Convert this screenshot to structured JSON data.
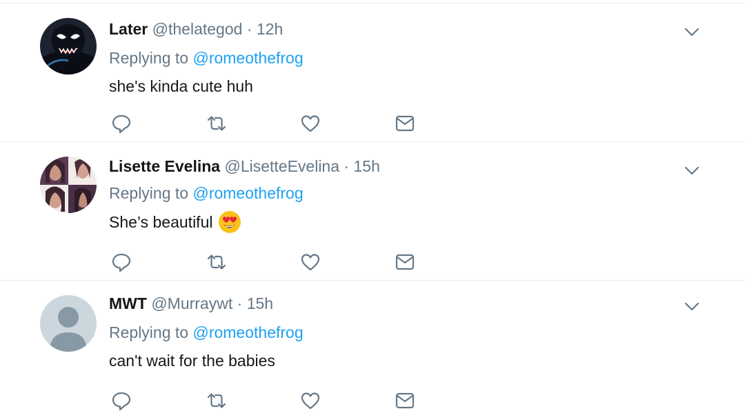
{
  "replies": [
    {
      "display_name": "Later",
      "handle": "@thelategod",
      "time": "12h",
      "replying_prefix": "Replying to",
      "replying_to": "@romeothefrog",
      "text": "she's kinda cute huh",
      "emoji": ""
    },
    {
      "display_name": "Lisette Evelina",
      "handle": "@LisetteEvelina",
      "time": "15h",
      "replying_prefix": "Replying to",
      "replying_to": "@romeothefrog",
      "text": "She’s beautiful",
      "emoji": "heart-eyes-emoji"
    },
    {
      "display_name": "MWT",
      "handle": "@Murraywt",
      "time": "15h",
      "replying_prefix": "Replying to",
      "replying_to": "@romeothefrog",
      "text": "can't wait for the babies",
      "emoji": ""
    }
  ],
  "separator": "·",
  "icons": {
    "reply": "reply-icon",
    "retweet": "retweet-icon",
    "like": "like-icon",
    "message": "message-icon",
    "more": "chevron-down-icon"
  },
  "colors": {
    "link": "#1da1f2",
    "muted": "#657786",
    "text": "#14171a",
    "divider": "#e6ecf0"
  }
}
